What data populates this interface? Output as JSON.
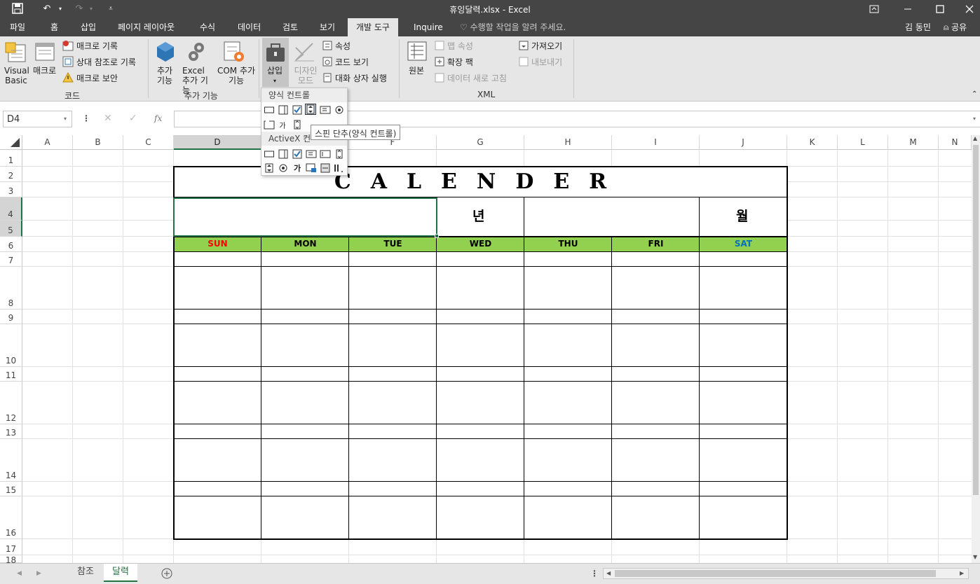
{
  "window": {
    "title": "휴잉달력.xlsx - Excel"
  },
  "qat": {
    "save_icon": "save-icon",
    "undo_icon": "undo-icon",
    "redo_icon": "redo-icon",
    "customize_icon": "customize-icon"
  },
  "tabs": [
    "파일",
    "홈",
    "삽입",
    "페이지 레이아웃",
    "수식",
    "데이터",
    "검토",
    "보기",
    "개발 도구",
    "Inquire"
  ],
  "tell_me": "수행할 작업을 알려 주세요.",
  "user": {
    "name": "김 동민",
    "share": "공유"
  },
  "ribbon": {
    "code": {
      "vb": "Visual Basic",
      "macro": "매크로",
      "record": "매크로 기록",
      "relative": "상대 참조로 기록",
      "security": "매크로 보안",
      "label": "코드"
    },
    "addins": {
      "addins": "추가 기능",
      "excel_addins": "Excel 추가 기능",
      "com": "COM 추가 기능",
      "label": "추가 기능"
    },
    "controls": {
      "insert": "삽입",
      "design": "디자인 모드",
      "props": "속성",
      "viewcode": "코드 보기",
      "dialog": "대화 상자 실행"
    },
    "xml": {
      "source": "원본",
      "map_props": "맵 속성",
      "ext_pack": "확장 팩",
      "refresh": "데이터 새로 고침",
      "import": "가져오기",
      "export": "내보내기",
      "label": "XML"
    }
  },
  "formula_bar": {
    "name_box": "D4",
    "fx": "fx",
    "value": ""
  },
  "columns": [
    "A",
    "B",
    "C",
    "D",
    "E",
    "F",
    "G",
    "H",
    "I",
    "J",
    "K",
    "L",
    "M",
    "N"
  ],
  "rows": [
    "1",
    "2",
    "3",
    "4",
    "5",
    "6",
    "7",
    "8",
    "9",
    "10",
    "11",
    "12",
    "13",
    "14",
    "15",
    "16",
    "17",
    "18"
  ],
  "calendar": {
    "title": "CALENDER",
    "year_label": "년",
    "month_label": "월",
    "days": [
      "SUN",
      "MON",
      "TUE",
      "WED",
      "THU",
      "FRI",
      "SAT"
    ]
  },
  "colors": {
    "header_green": "#92d050",
    "sun_red": "#ff0000",
    "sat_blue": "#0070c0",
    "excel_green": "#217346"
  },
  "dropdown": {
    "form_controls": "양식 컨트롤",
    "activex": "ActiveX 컨",
    "tooltip": "스핀 단추(양식 컨트롤)"
  },
  "sheets": [
    "참조",
    "달력"
  ]
}
